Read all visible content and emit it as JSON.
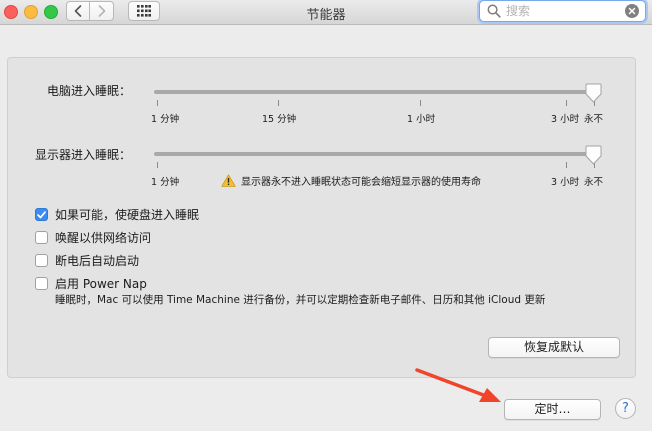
{
  "window": {
    "title": "节能器"
  },
  "search": {
    "placeholder": "搜索",
    "value": ""
  },
  "computer_sleep": {
    "label": "电脑进入睡眠：",
    "level": 1.0,
    "ticks": [
      "1 分钟",
      "15 分钟",
      "1 小时",
      "3 小时",
      "永不"
    ],
    "selected": "永不"
  },
  "display_sleep": {
    "label": "显示器进入睡眠：",
    "level": 1.0,
    "ticks": [
      "1 分钟",
      "3 小时",
      "永不"
    ],
    "selected": "永不",
    "warning": "显示器永不进入睡眠状态可能会缩短显示器的使用寿命"
  },
  "options": [
    {
      "label": "如果可能，使硬盘进入睡眠",
      "checked": true
    },
    {
      "label": "唤醒以供网络访问",
      "checked": false
    },
    {
      "label": "断电后自动启动",
      "checked": false
    },
    {
      "label": "启用 Power Nap",
      "checked": false
    }
  ],
  "power_nap_note": "睡眠时，Mac 可以使用 Time Machine 进行备份，并可以定期检查新电子邮件、日历和其他 iCloud 更新",
  "buttons": {
    "restore_defaults": "恢复成默认",
    "schedule": "定时…",
    "help": "?"
  },
  "colors": {
    "accent": "#3a8cf1",
    "annotation_arrow": "#f0452a"
  },
  "icons": {
    "back": "chevron-left-icon",
    "forward": "chevron-right-icon",
    "grid": "grid-icon",
    "search": "search-icon",
    "clear": "clear-icon",
    "warning": "warning-icon",
    "check": "checkmark-icon"
  }
}
